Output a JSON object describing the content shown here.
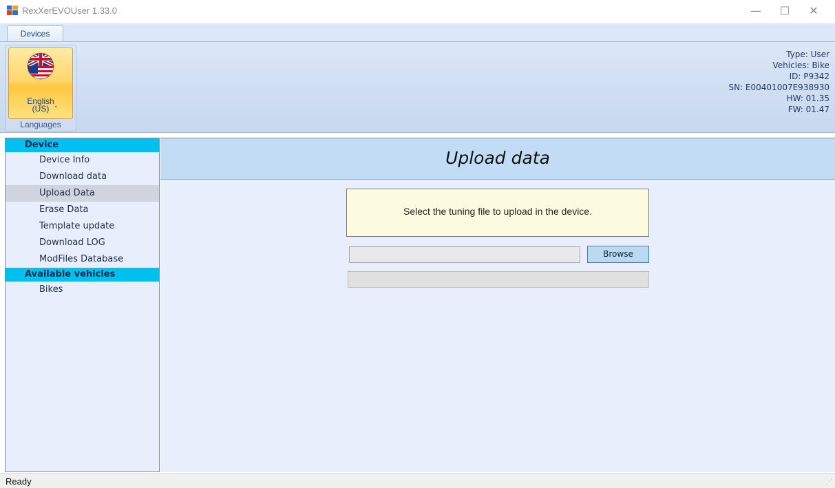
{
  "window": {
    "title": "RexXerEVOUser 1.33.0",
    "minimize_glyph": "—",
    "maximize_glyph": "☐",
    "close_glyph": "✕"
  },
  "ribbon": {
    "tab": "Devices",
    "language": {
      "line1": "English",
      "line2": "(US)",
      "caret": "⌄",
      "flag_icon": "uk-us-flag-icon"
    },
    "group_caption": "Languages",
    "device_info": {
      "type": "Type: User",
      "vehicles": "Vehicles: Bike",
      "id": "ID: P9342",
      "sn": "SN: E00401007E938930",
      "hw": "HW: 01.35",
      "fw": "FW: 01.47"
    }
  },
  "sidebar": {
    "categories": [
      {
        "header": "Device",
        "items": [
          "Device Info",
          "Download data",
          "Upload Data",
          "Erase Data",
          "Template update",
          "Download LOG",
          "ModFiles Database"
        ]
      },
      {
        "header": "Available vehicles",
        "items": [
          "Bikes"
        ]
      }
    ],
    "selected": "Upload Data"
  },
  "main": {
    "title": "Upload data",
    "instruction": "Select the tuning file to upload in the device.",
    "file_path": "",
    "browse_label": "Browse",
    "progress": 0
  },
  "status": {
    "text": "Ready",
    "grip": "⋰"
  },
  "colors": {
    "category_header": "#00c0f0",
    "header_band": "#c2dcf6",
    "panel_bg": "#e8eefb",
    "info_box_bg": "#fdfbdf"
  }
}
